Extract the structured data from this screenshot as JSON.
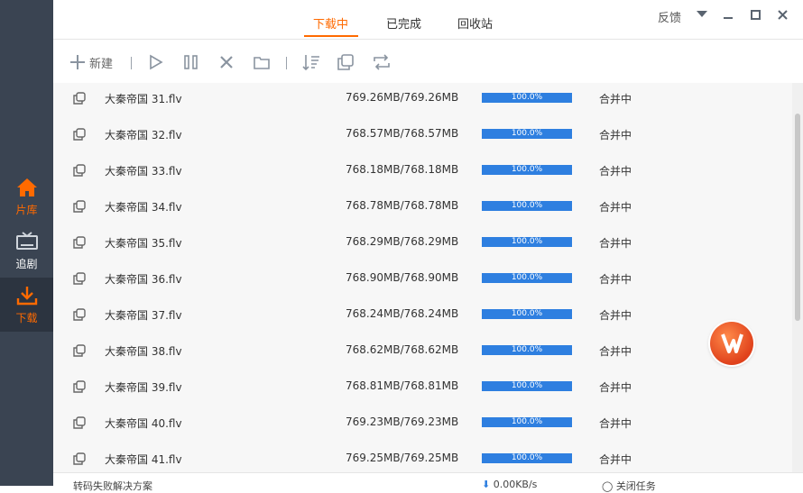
{
  "sidebar": {
    "items": [
      {
        "label": "片库",
        "icon": "home-icon"
      },
      {
        "label": "追剧",
        "icon": "tv-icon"
      },
      {
        "label": "下载",
        "icon": "download-icon"
      }
    ]
  },
  "tabs": [
    "下载中",
    "已完成",
    "回收站"
  ],
  "header": {
    "feedback": "反馈"
  },
  "toolbar": {
    "new_label": "新建"
  },
  "downloads": [
    {
      "name": "大秦帝国 31.flv",
      "size": "769.26MB/769.26MB",
      "progress": "100.0%",
      "status": "合并中"
    },
    {
      "name": "大秦帝国 32.flv",
      "size": "768.57MB/768.57MB",
      "progress": "100.0%",
      "status": "合并中"
    },
    {
      "name": "大秦帝国 33.flv",
      "size": "768.18MB/768.18MB",
      "progress": "100.0%",
      "status": "合并中"
    },
    {
      "name": "大秦帝国 34.flv",
      "size": "768.78MB/768.78MB",
      "progress": "100.0%",
      "status": "合并中"
    },
    {
      "name": "大秦帝国 35.flv",
      "size": "768.29MB/768.29MB",
      "progress": "100.0%",
      "status": "合并中"
    },
    {
      "name": "大秦帝国 36.flv",
      "size": "768.90MB/768.90MB",
      "progress": "100.0%",
      "status": "合并中"
    },
    {
      "name": "大秦帝国 37.flv",
      "size": "768.24MB/768.24MB",
      "progress": "100.0%",
      "status": "合并中"
    },
    {
      "name": "大秦帝国 38.flv",
      "size": "768.62MB/768.62MB",
      "progress": "100.0%",
      "status": "合并中"
    },
    {
      "name": "大秦帝国 39.flv",
      "size": "768.81MB/768.81MB",
      "progress": "100.0%",
      "status": "合并中"
    },
    {
      "name": "大秦帝国 40.flv",
      "size": "769.23MB/769.23MB",
      "progress": "100.0%",
      "status": "合并中"
    },
    {
      "name": "大秦帝国 41.flv",
      "size": "769.25MB/769.25MB",
      "progress": "100.0%",
      "status": "合并中"
    }
  ],
  "footer": {
    "left_text": "转码失败解决方案",
    "speed": "0.00KB/s",
    "task_text": "关闭任务"
  },
  "colors": {
    "accent": "#ff6a00",
    "progress": "#2e7fe0",
    "sidebar": "#3a4452"
  }
}
